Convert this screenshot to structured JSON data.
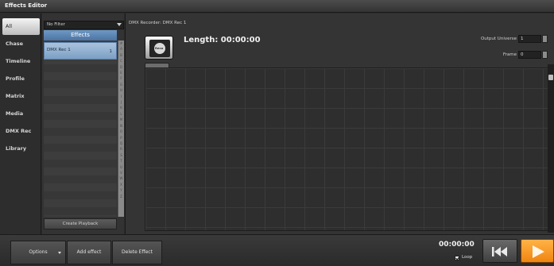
{
  "window": {
    "title": "Effects Editor"
  },
  "categories": [
    "All",
    "Chase",
    "Timeline",
    "Profile",
    "Matrix",
    "Media",
    "DMX Rec",
    "Library"
  ],
  "selected_category": "All",
  "filter": {
    "value": "No Filter"
  },
  "effects_list": {
    "header": "Effects",
    "items": [
      {
        "name": "DMX Rec 1",
        "number": "1"
      }
    ],
    "alpha_index": [
      "#",
      "A",
      "B",
      "C",
      "D",
      "E",
      "F",
      "G",
      "H",
      "I",
      "J",
      "K",
      "L",
      "M",
      "N",
      "O",
      "P",
      "Q",
      "R",
      "S",
      "T",
      "U",
      "V",
      "W",
      "X",
      "Y",
      "Z",
      "",
      "",
      ""
    ],
    "create_playback_label": "Create Playback"
  },
  "recorder": {
    "title": "DMX Recorder: DMX Rec 1",
    "record_button_label": "Reco",
    "length_text": "Length: 00:00:00",
    "output_universe_label": "Output Universe",
    "output_universe_value": "1",
    "frame_label": "Frame",
    "frame_value": "0"
  },
  "toolbar": {
    "options_label": "Options",
    "add_effect_label": "Add effect",
    "delete_effect_label": "Delete Effect",
    "time": "00:00:00",
    "loop_label": "Loop",
    "loop_checked": true
  },
  "colors": {
    "accent_blue": "#6e98c4",
    "play_orange": "#f08410"
  }
}
